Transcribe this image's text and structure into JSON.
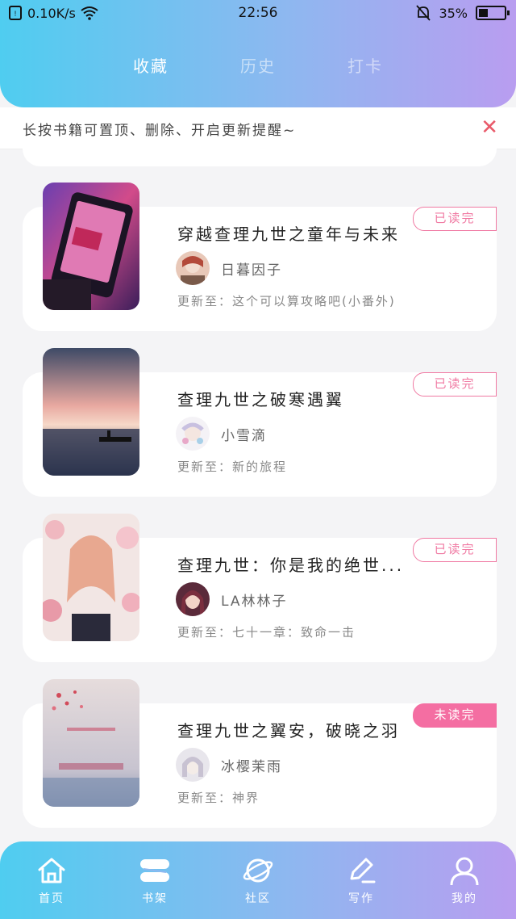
{
  "status_bar": {
    "speed": "0.10K/s",
    "time": "22:56",
    "battery": "35%",
    "battery_level": 0.35
  },
  "tabs": [
    {
      "label": "收藏",
      "active": true
    },
    {
      "label": "历史",
      "active": false
    },
    {
      "label": "打卡",
      "active": false
    }
  ],
  "notice": {
    "text": "长按书籍可置顶、删除、开启更新提醒~",
    "close_icon": "close-icon"
  },
  "books": [
    {
      "title": "穿越查理九世之童年与未来",
      "author": "日暮因子",
      "update": "更新至：这个可以算攻略吧(小番外)",
      "badge": "已读完",
      "unread": false
    },
    {
      "title": "查理九世之破寒遇翼",
      "author": "小雪滴",
      "update": "更新至：新的旅程",
      "badge": "已读完",
      "unread": false
    },
    {
      "title": "查理九世：你是我的绝世...",
      "author": "LA林林子",
      "update": "更新至：七十一章：致命一击",
      "badge": "已读完",
      "unread": false
    },
    {
      "title": "查理九世之翼安，破晓之羽",
      "author": "冰樱茉雨",
      "update": "更新至：神界",
      "badge": "未读完",
      "unread": true
    }
  ],
  "nav": [
    {
      "label": "首页",
      "icon": "home-icon"
    },
    {
      "label": "书架",
      "icon": "bookshelf-icon"
    },
    {
      "label": "社区",
      "icon": "planet-icon"
    },
    {
      "label": "写作",
      "icon": "pen-icon"
    },
    {
      "label": "我的",
      "icon": "user-icon"
    }
  ],
  "colors": {
    "accent_pink": "#f07aa3",
    "unread_badge": "#f46ea2",
    "gradient_start": "#4fcdf0",
    "gradient_end": "#b99df0"
  }
}
